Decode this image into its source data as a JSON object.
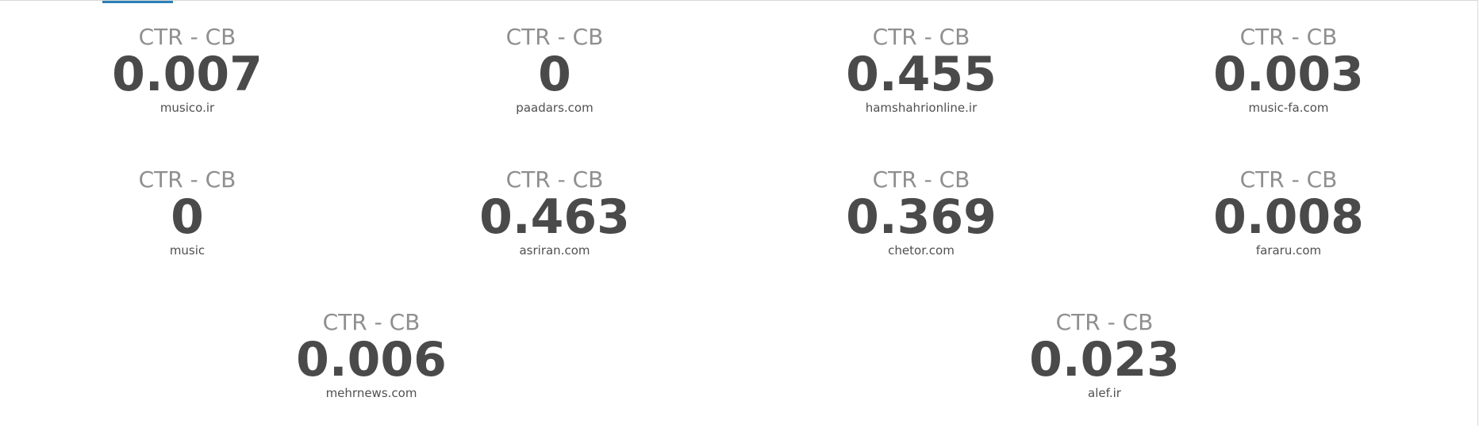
{
  "colors": {
    "label": "#8f8f8f",
    "value": "#4a4a4a",
    "caption": "#505050",
    "accent": "#2a7fb8"
  },
  "stats": [
    {
      "label": "CTR - CB",
      "value": "0.007",
      "caption": "musico.ir"
    },
    {
      "label": "CTR - CB",
      "value": "0",
      "caption": "paadars.com"
    },
    {
      "label": "CTR - CB",
      "value": "0.455",
      "caption": "hamshahrionline.ir"
    },
    {
      "label": "CTR - CB",
      "value": "0.003",
      "caption": "music-fa.com"
    },
    {
      "label": "CTR - CB",
      "value": "0",
      "caption": "music"
    },
    {
      "label": "CTR - CB",
      "value": "0.463",
      "caption": "asriran.com"
    },
    {
      "label": "CTR - CB",
      "value": "0.369",
      "caption": "chetor.com"
    },
    {
      "label": "CTR - CB",
      "value": "0.008",
      "caption": "fararu.com"
    },
    {
      "label": "CTR - CB",
      "value": "0.006",
      "caption": "mehrnews.com"
    },
    {
      "label": "CTR - CB",
      "value": "0.023",
      "caption": "alef.ir"
    }
  ]
}
